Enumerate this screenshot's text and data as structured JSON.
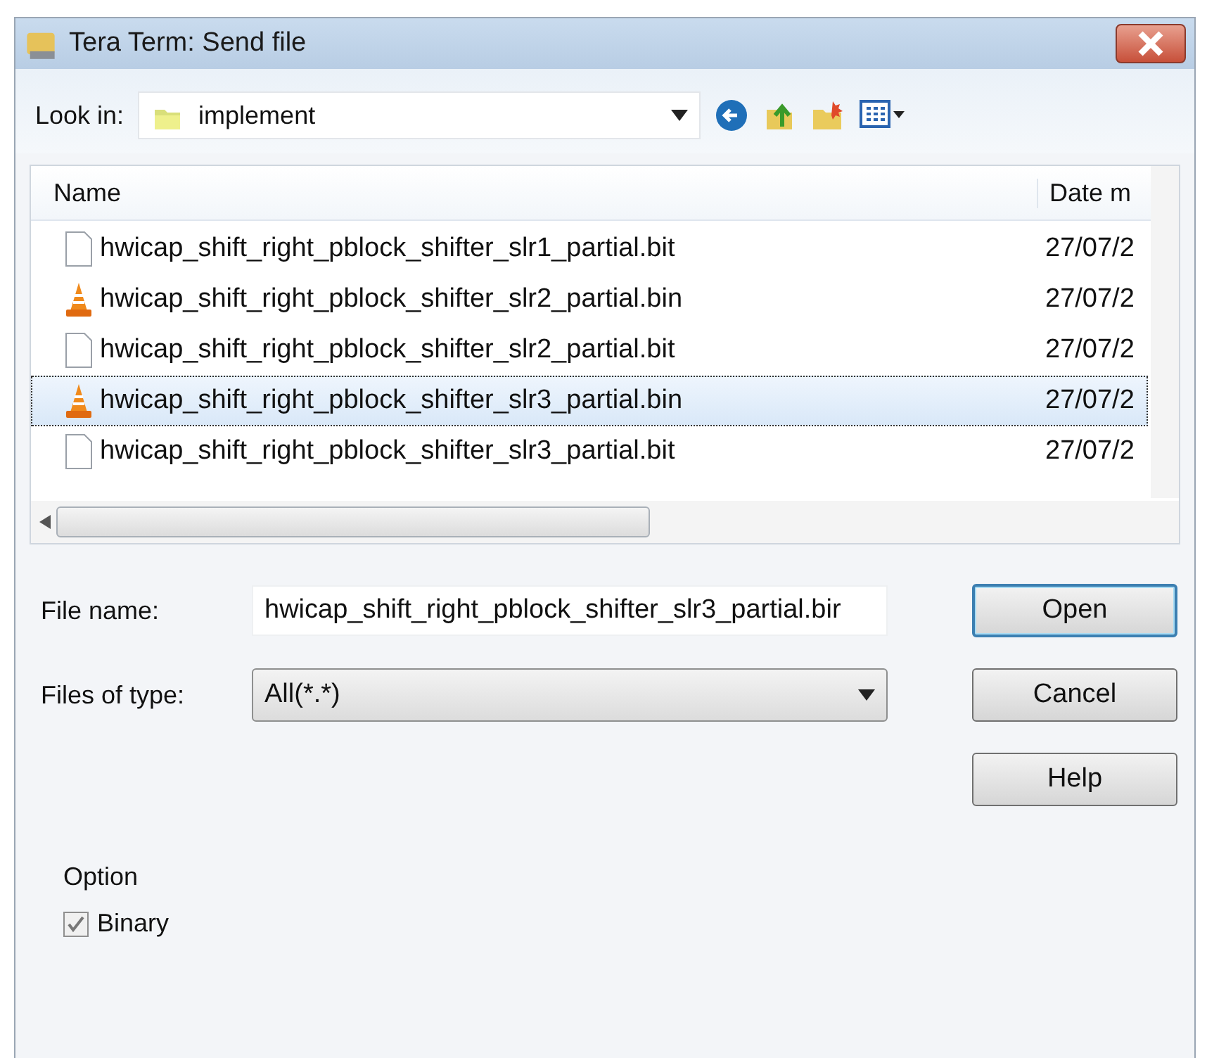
{
  "window": {
    "title": "Tera Term: Send file"
  },
  "look_in": {
    "label": "Look in:",
    "value": "implement"
  },
  "file_list": {
    "columns": [
      "Name",
      "Date m"
    ],
    "rows": [
      {
        "kind": "bit",
        "name": "hwicap_shift_right_pblock_shifter_slr1_partial.bit",
        "date": "27/07/2",
        "selected": false
      },
      {
        "kind": "bin",
        "name": "hwicap_shift_right_pblock_shifter_slr2_partial.bin",
        "date": "27/07/2",
        "selected": false
      },
      {
        "kind": "bit",
        "name": "hwicap_shift_right_pblock_shifter_slr2_partial.bit",
        "date": "27/07/2",
        "selected": false
      },
      {
        "kind": "bin",
        "name": "hwicap_shift_right_pblock_shifter_slr3_partial.bin",
        "date": "27/07/2",
        "selected": true
      },
      {
        "kind": "bit",
        "name": "hwicap_shift_right_pblock_shifter_slr3_partial.bit",
        "date": "27/07/2",
        "selected": false
      }
    ]
  },
  "file_name": {
    "label": "File name:",
    "value": "hwicap_shift_right_pblock_shifter_slr3_partial.bir"
  },
  "file_type": {
    "label": "Files of type:",
    "value": "All(*.*)"
  },
  "buttons": [
    {
      "label": "Open",
      "default": true
    },
    {
      "label": "Cancel",
      "default": false
    },
    {
      "label": "Help",
      "default": false
    }
  ],
  "option": {
    "label": "Option",
    "checkbox": {
      "label": "Binary",
      "checked": true
    }
  }
}
